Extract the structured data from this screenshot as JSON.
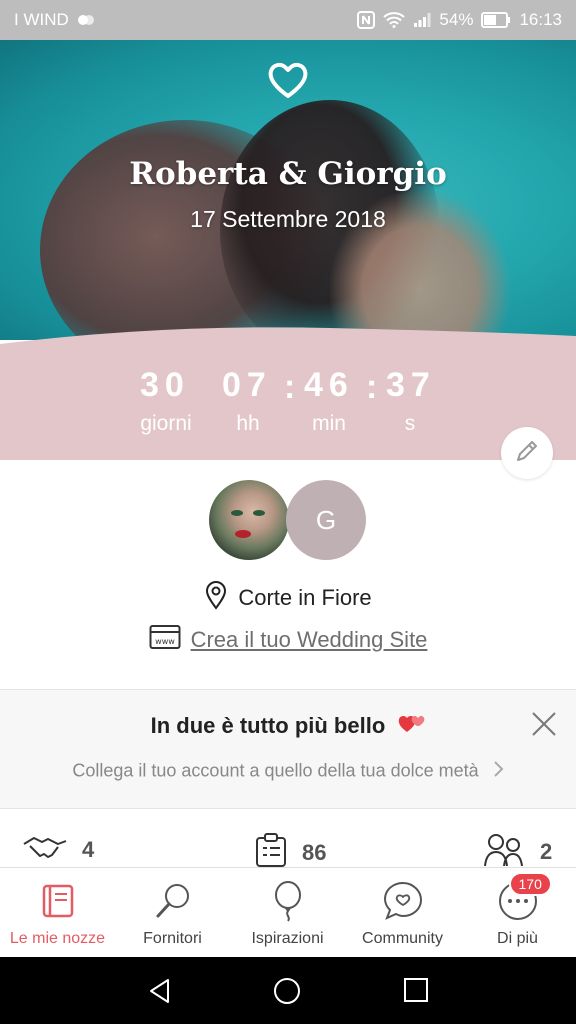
{
  "status_bar": {
    "carrier": "I WIND",
    "battery": "54%",
    "time": "16:13"
  },
  "hero": {
    "couple": "Roberta & Giorgio",
    "date": "17 Settembre 2018"
  },
  "countdown": {
    "days": "30",
    "hours": "07",
    "minutes": "46",
    "seconds": "37",
    "days_label": "giorni",
    "hours_label": "hh",
    "minutes_label": "min",
    "seconds_label": "s"
  },
  "profile": {
    "partner_initial": "G",
    "venue": "Corte in Fiore",
    "site_link": "Crea il tuo Wedding Site"
  },
  "promo": {
    "title": "In due è tutto più bello",
    "subtitle": "Collega il tuo account a quello della tua dolce metà"
  },
  "stats": {
    "vendors": "4",
    "tasks": "86",
    "guests": "2"
  },
  "tabs": [
    {
      "label": "Le mie nozze",
      "icon": "notebook-icon"
    },
    {
      "label": "Fornitori",
      "icon": "search-icon"
    },
    {
      "label": "Ispirazioni",
      "icon": "balloon-icon"
    },
    {
      "label": "Community",
      "icon": "chat-heart-icon"
    },
    {
      "label": "Di più",
      "icon": "more-icon",
      "badge": "170"
    }
  ],
  "colors": {
    "accent": "#e35c64",
    "countdown_bg": "#e3c6c9",
    "sea": "#27b6bd",
    "badge": "#e9424b"
  }
}
